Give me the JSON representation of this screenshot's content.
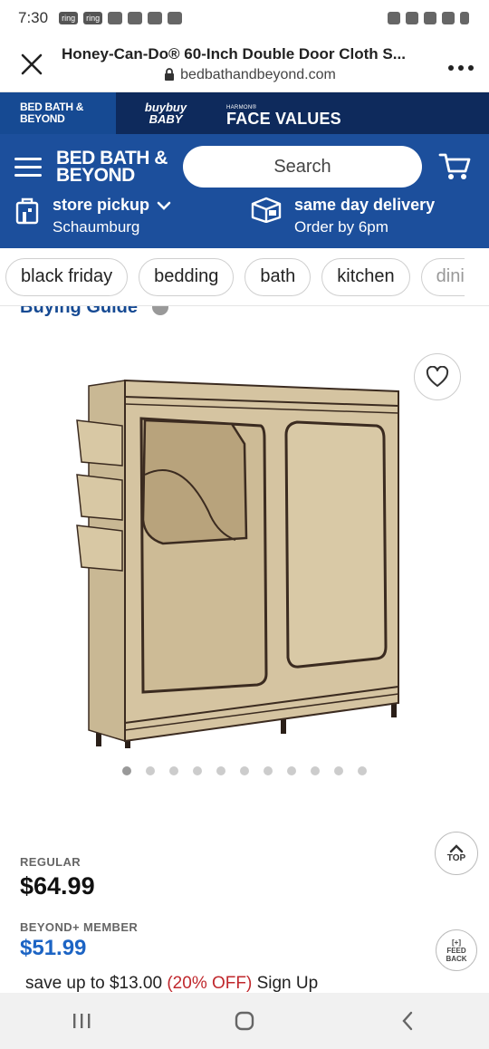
{
  "status_bar": {
    "time": "7:30",
    "notif_badges": [
      "ring",
      "ring"
    ]
  },
  "browser": {
    "page_title": "Honey-Can-Do® 60-Inch Double Door Cloth S...",
    "domain": "bedbathandbeyond.com"
  },
  "brand_bar": {
    "brand1_line1": "BED BATH &",
    "brand1_line2": "BEYOND",
    "brand2_line1": "buybuy",
    "brand2_line2": "BABY",
    "brand3_small": "HARMON®",
    "brand3_big": "FACE VALUES"
  },
  "header": {
    "logo_line1": "BED BATH &",
    "logo_line2": "BEYOND",
    "search_placeholder": "Search",
    "pickup_title": "store pickup",
    "pickup_store": "Schaumburg",
    "delivery_title": "same day delivery",
    "delivery_sub": "Order by 6pm"
  },
  "chips": [
    "black friday",
    "bedding",
    "bath",
    "kitchen",
    "dini"
  ],
  "guide_text": "Buying Guide",
  "carousel": {
    "total": 11,
    "active_index": 0
  },
  "prices": {
    "regular_label": "REGULAR",
    "regular_price": "$64.99",
    "member_label": "BEYOND+ MEMBER",
    "member_price": "$51.99",
    "save_prefix": "save up to $13.00",
    "save_pct": "(20% OFF)",
    "save_suffix": "Sign Up"
  },
  "floating": {
    "top_label": "TOP",
    "feedback_line1": "[+]",
    "feedback_line2": "FEED",
    "feedback_line3": "BACK"
  },
  "colors": {
    "brand_navy": "#0e2a5c",
    "brand_blue": "#1c4f9c",
    "member_blue": "#1c64c4",
    "discount_red": "#c0282d"
  }
}
